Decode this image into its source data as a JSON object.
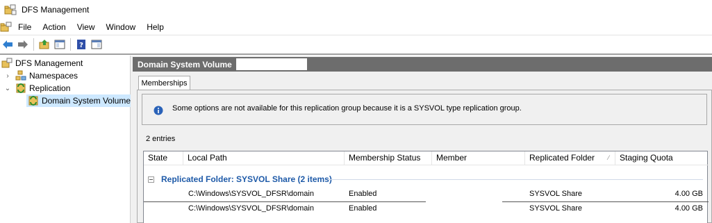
{
  "window": {
    "title": "DFS Management"
  },
  "menu": {
    "items": [
      "File",
      "Action",
      "View",
      "Window",
      "Help"
    ]
  },
  "toolbar": {
    "buttons": [
      "back-arrow-icon",
      "forward-arrow-icon",
      "up-folder-icon",
      "show-hide-tree-icon",
      "help-icon",
      "show-hide-action-pane-icon"
    ]
  },
  "tree": {
    "root": "DFS Management",
    "namespaces": "Namespaces",
    "replication": "Replication",
    "selected_group": "Domain System Volume"
  },
  "pane": {
    "title": "Domain System Volume",
    "tab": "Memberships",
    "info_message": "Some options are not available for this replication group because it is a SYSVOL type replication group.",
    "entries_count": "2 entries"
  },
  "table": {
    "columns": [
      "State",
      "Local Path",
      "Membership Status",
      "Member",
      "Replicated Folder",
      "Staging Quota"
    ],
    "group_label": "Replicated Folder: SYSVOL Share (2 items)",
    "rows": [
      {
        "state": "",
        "local_path": "C:\\Windows\\SYSVOL_DFSR\\domain",
        "membership_status": "Enabled",
        "member": "",
        "replicated_folder": "SYSVOL Share",
        "staging_quota": "4.00 GB"
      },
      {
        "state": "",
        "local_path": "C:\\Windows\\SYSVOL_DFSR\\domain",
        "membership_status": "Enabled",
        "member": "",
        "replicated_folder": "SYSVOL Share",
        "staging_quota": "4.00 GB"
      }
    ]
  },
  "colors": {
    "group_header": "#1e5aa8",
    "pane_header_bg": "#6d6d6d",
    "selection": "#cde8ff"
  }
}
